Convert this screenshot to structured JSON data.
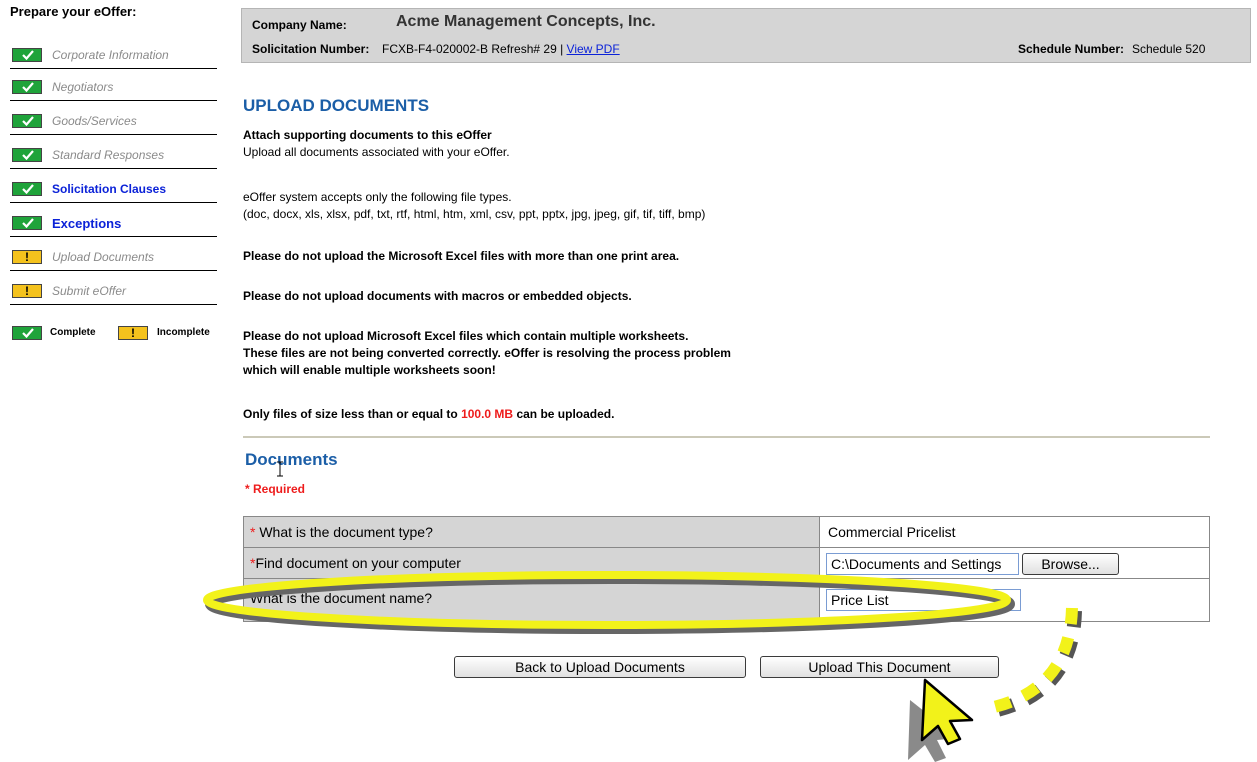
{
  "sidebar": {
    "heading": "Prepare your eOffer:",
    "items": [
      {
        "label": "Corporate Information",
        "status": "complete",
        "style": "done"
      },
      {
        "label": "Negotiators",
        "status": "complete",
        "style": "done"
      },
      {
        "label": "Goods/Services",
        "status": "complete",
        "style": "done"
      },
      {
        "label": "Standard Responses",
        "status": "complete",
        "style": "done"
      },
      {
        "label": "Solicitation Clauses",
        "status": "complete",
        "style": "link"
      },
      {
        "label": "Exceptions",
        "status": "complete",
        "style": "link"
      },
      {
        "label": "Upload Documents",
        "status": "incomplete",
        "style": "done"
      },
      {
        "label": "Submit eOffer",
        "status": "incomplete",
        "style": "done"
      }
    ],
    "legend": {
      "complete": "Complete",
      "incomplete": "Incomplete"
    },
    "warn_glyph": "!"
  },
  "header": {
    "company_label": "Company Name:",
    "company_name": "Acme Management Concepts, Inc.",
    "solicitation_label": "Solicitation Number:",
    "solicitation_value": "FCXB-F4-020002-B Refresh# 29 |",
    "view_pdf": "View PDF",
    "schedule_label": "Schedule Number:",
    "schedule_value": "Schedule 520"
  },
  "main": {
    "title": "UPLOAD DOCUMENTS",
    "subtitle": "Attach supporting documents to this eOffer",
    "intro": "Upload all documents associated with your eOffer.",
    "filetypes_line1": "eOffer system accepts only the following file types.",
    "filetypes_line2": "(doc, docx, xls, xlsx, pdf, txt, rtf, html, htm, xml, csv, ppt, pptx, jpg, jpeg, gif, tif, tiff, bmp)",
    "warn_print_area": "Please do not upload the Microsoft Excel files with more than one print area.",
    "warn_macros": "Please do not upload documents with macros or embedded objects.",
    "warn_worksheets_1": "Please do not upload Microsoft Excel files which contain multiple worksheets.",
    "warn_worksheets_2": "These files are not being converted correctly. eOffer is resolving the process problem",
    "warn_worksheets_3": "which will enable multiple worksheets soon!",
    "size_prefix": "Only files of size less than or equal to",
    "size_value": "100.0 MB",
    "size_suffix": "can be uploaded."
  },
  "documents": {
    "title": "Documents",
    "required": "* Required",
    "required_star": "*",
    "rows": [
      {
        "question": "What is the document type?",
        "value": "Commercial Pricelist"
      },
      {
        "question": "Find document on your computer",
        "value": "C:\\Documents and Settings"
      },
      {
        "question": "What is the document name?",
        "value": "Price List"
      }
    ],
    "browse_label": "Browse..."
  },
  "buttons": {
    "back": "Back to Upload Documents",
    "upload": "Upload This Document"
  },
  "colors": {
    "complete": "#1fa33a",
    "incomplete": "#f4c21d",
    "title_blue": "#1b5ea7",
    "link_blue": "#0b22d8",
    "required_red": "#ee1c1c",
    "highlight_yellow": "#f2f21a"
  }
}
